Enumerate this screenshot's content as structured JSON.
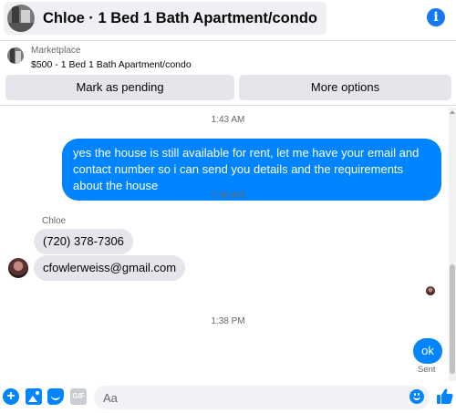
{
  "header": {
    "title": "Chloe · 1 Bed 1 Bath Apartment/condo",
    "info_icon": "info-icon"
  },
  "marketplace": {
    "label": "Marketplace",
    "listing": "$500 - 1 Bed 1 Bath Apartment/condo",
    "buttons": {
      "mark_pending": "Mark as pending",
      "more_options": "More options"
    }
  },
  "conversation": {
    "timestamps": [
      "1:43 AM",
      "7:36 AM",
      "1:38 PM"
    ],
    "outgoing_message_1": "yes the house is still available for rent, let me have your email  and contact number so i can send you details and the requirements about the house",
    "sender_name": "Chloe",
    "incoming_messages": [
      "(720) 378-7306",
      "cfowlerweiss@gmail.com"
    ],
    "outgoing_message_2": "ok",
    "status": "Sent"
  },
  "composer": {
    "placeholder": "Aa",
    "gif_label": "GIF",
    "plus_symbol": "+"
  },
  "colors": {
    "accent": "#0084ff",
    "brand_blue": "#1877f2",
    "incoming_bubble": "#e4e6eb",
    "muted_text": "#65676b"
  }
}
